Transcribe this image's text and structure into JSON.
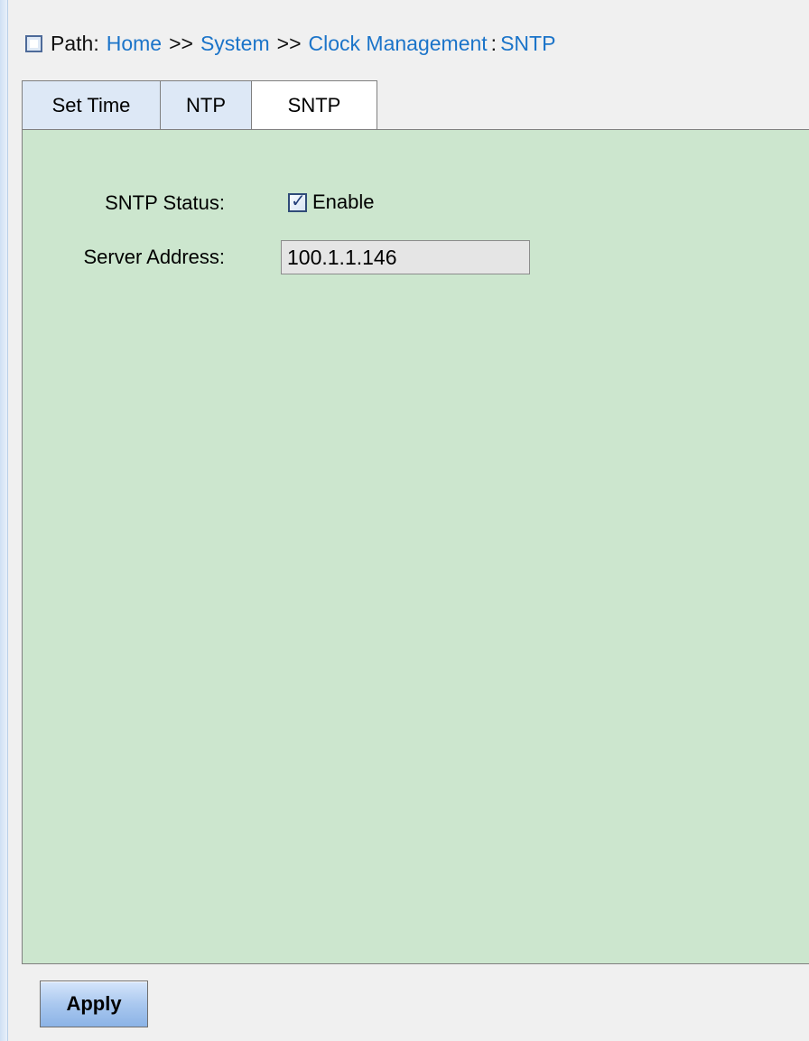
{
  "breadcrumb": {
    "icon": "square-icon",
    "label": "Path:",
    "home": "Home",
    "separator_1": ">>",
    "system": "System",
    "separator_2": ">>",
    "clock_management": "Clock Management",
    "colon": ":",
    "current": "SNTP"
  },
  "tabs": [
    {
      "label": "Set Time",
      "active": false
    },
    {
      "label": "NTP",
      "active": false
    },
    {
      "label": "SNTP",
      "active": true
    }
  ],
  "form": {
    "sntp_status_label": "SNTP Status:",
    "enable_checked": true,
    "enable_label": "Enable",
    "server_address_label": "Server Address:",
    "server_address_value": "100.1.1.146"
  },
  "buttons": {
    "apply": "Apply"
  },
  "colors": {
    "link": "#1b74c9",
    "panel_background": "#cce6ce",
    "active_tab": "#ffffff",
    "inactive_tab": "#dde8f6",
    "button": "#aac8ef"
  }
}
